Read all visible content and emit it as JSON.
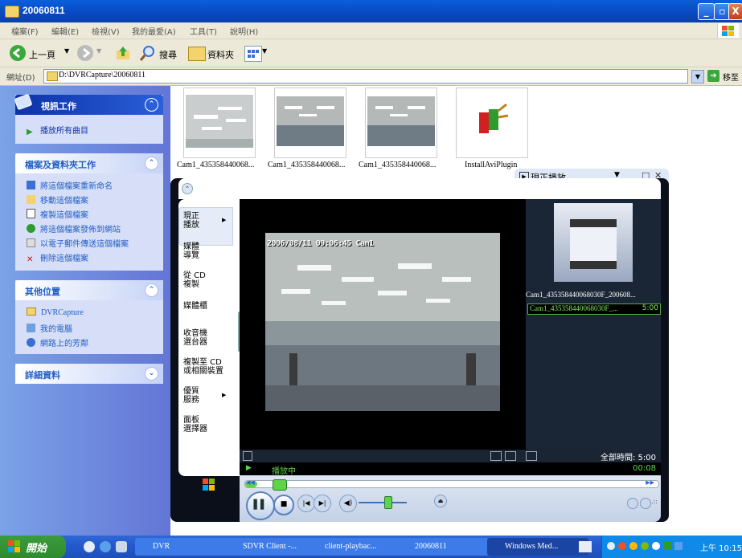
{
  "window": {
    "title": "20060811"
  },
  "menu": [
    "檔案(F)",
    "編輯(E)",
    "檢視(V)",
    "我的最愛(A)",
    "工具(T)",
    "說明(H)"
  ],
  "toolbar": {
    "back": "上一頁",
    "search": "搜尋",
    "folders": "資料夾"
  },
  "address": {
    "label": "網址(D)",
    "value": "D:\\DVRCapture\\20060811",
    "go": "移至"
  },
  "panels": {
    "video_tasks": {
      "title": "視訊工作",
      "items": [
        "播放所有曲目"
      ]
    },
    "file_tasks": {
      "title": "檔案及資料夾工作",
      "items": [
        "將這個檔案重新命名",
        "移動這個檔案",
        "複製這個檔案",
        "將這個檔案發佈到網站",
        "以電子郵件傳送這個檔案",
        "刪除這個檔案"
      ]
    },
    "other_places": {
      "title": "其他位置",
      "items": [
        "DVRCapture",
        "我的電腦",
        "網路上的芳鄰"
      ]
    },
    "details": {
      "title": "詳細資料"
    }
  },
  "files": [
    {
      "name": "Cam1_435358440068..."
    },
    {
      "name": "Cam1_435358440068..."
    },
    {
      "name": "Cam1_435358440068..."
    },
    {
      "name": "InstallAviPlugin"
    }
  ],
  "player": {
    "view": "現正播放",
    "tasks": [
      "現正\n播放",
      "媒體\n導覽",
      "從 CD\n複製",
      "媒體櫃",
      "收音機\n選台器",
      "複製至 CD\n或相關裝置",
      "優質\n服務",
      "面板\n選擇器"
    ],
    "overlay": "2006/08/11 09:06:45 Cam1",
    "playlist_title": "Cam1_435358440068030F_200608...",
    "playlist_item": "Cam1_435358440068030F_...",
    "playlist_duration": "5:00",
    "total_time": "全部時間: 5:00",
    "status": "播放中",
    "elapsed": "00:08",
    "position_fraction": 0.03
  },
  "taskbar": {
    "start": "開始",
    "buttons": [
      "DVR",
      "SDVR Client -...",
      "client-playbac...",
      "20060811",
      "Windows Med..."
    ],
    "clock": "上午 10:15"
  },
  "colors": {
    "xp_blue": "#0848c0",
    "task_pane": "#6375d6",
    "wmp_dark": "#0a0f1a",
    "progress_green": "#5fd34a"
  }
}
